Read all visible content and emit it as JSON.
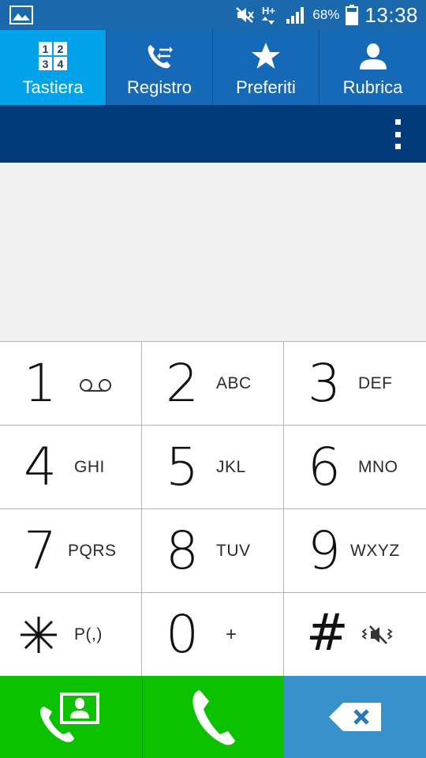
{
  "status_bar": {
    "battery_percent": "68%",
    "time": "13:38",
    "network": "H+",
    "icons": [
      "gallery-icon",
      "mute-icon",
      "network-hplus-icon",
      "signal-icon",
      "battery-icon"
    ]
  },
  "tabs": [
    {
      "label": "Tastiera",
      "icon": "keypad-icon",
      "active": true
    },
    {
      "label": "Registro",
      "icon": "call-log-icon",
      "active": false
    },
    {
      "label": "Preferiti",
      "icon": "star-icon",
      "active": false
    },
    {
      "label": "Rubrica",
      "icon": "contact-icon",
      "active": false
    }
  ],
  "action_bar": {
    "overflow_icon": "overflow-menu-icon"
  },
  "number_display": {
    "value": ""
  },
  "keypad": {
    "keys": [
      {
        "digit": "1",
        "letters": "",
        "icon": "voicemail-icon"
      },
      {
        "digit": "2",
        "letters": "ABC"
      },
      {
        "digit": "3",
        "letters": "DEF"
      },
      {
        "digit": "4",
        "letters": "GHI"
      },
      {
        "digit": "5",
        "letters": "JKL"
      },
      {
        "digit": "6",
        "letters": "MNO"
      },
      {
        "digit": "7",
        "letters": "PQRS"
      },
      {
        "digit": "8",
        "letters": "TUV"
      },
      {
        "digit": "9",
        "letters": "WXYZ"
      },
      {
        "digit": "*",
        "letters": "P(,)"
      },
      {
        "digit": "0",
        "letters": "+"
      },
      {
        "digit": "#",
        "letters": "",
        "icon": "vibrate-mute-icon"
      }
    ]
  },
  "bottom_actions": [
    {
      "name": "video-call-contact",
      "icon": "contact-call-icon"
    },
    {
      "name": "call",
      "icon": "phone-icon"
    },
    {
      "name": "delete",
      "icon": "backspace-icon"
    }
  ],
  "colors": {
    "status_bar": "#1c68ad",
    "tab_bar": "#1669b6",
    "tab_active": "#02a2ea",
    "action_bar": "#003a78",
    "display_bg": "#f0f0f0",
    "call_green": "#0cc100",
    "delete_blue": "#3991cb"
  }
}
